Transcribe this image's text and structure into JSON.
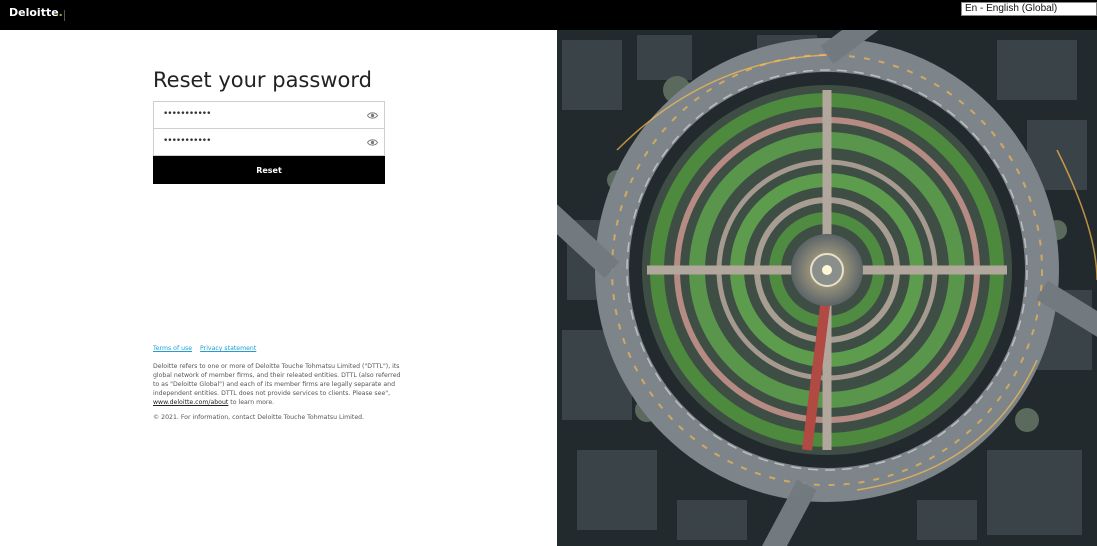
{
  "header": {
    "brand": "Deloitte",
    "brand_dot": ".",
    "language": "En - English (Global)"
  },
  "form": {
    "title": "Reset your password",
    "new_password_masked": "•••••••••••",
    "confirm_password_masked": "•••••••••••",
    "reset_label": "Reset"
  },
  "footer": {
    "terms_label": "Terms of use",
    "privacy_label": "Privacy statement",
    "disclaimer": "Deloitte refers to one or more of Deloitte Touche Tohmatsu Limited (\"DTTL\"), its global network of member firms, and their releated entities. DTTL (also referred to as \"Deloitte Global\") and each of its member firms are legally separate and independent entities. DTTL does not provide services to clients. Please see\",",
    "about_link": "www.deloitte.com/about",
    "learn_more": "to learn more.",
    "copyright": "© 2021. For information, contact Deloitte Touche Tohmatsu Limited."
  },
  "colors": {
    "brand_green": "#86bc25",
    "link_blue": "#1e9fd6",
    "button_black": "#000000"
  },
  "icons": {
    "password_toggle": "eye-icon"
  }
}
